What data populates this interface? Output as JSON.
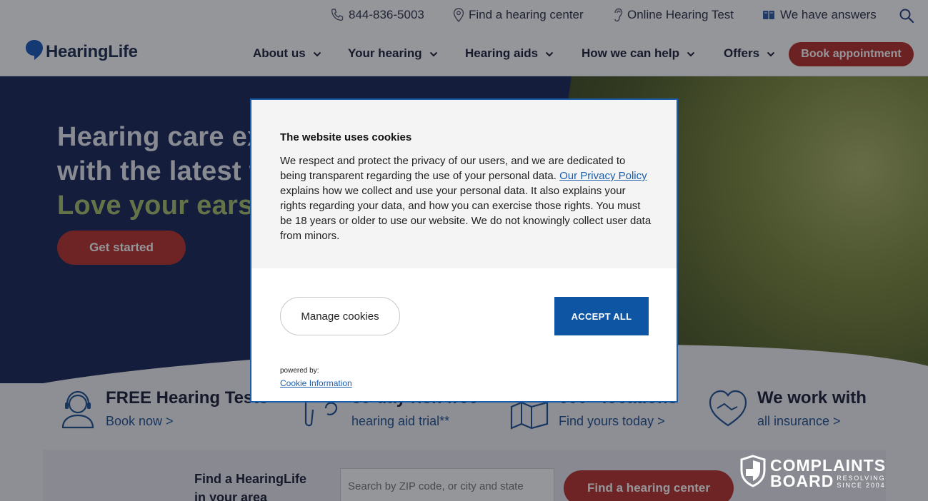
{
  "utility_bar": {
    "phone": "844-836-5003",
    "find_center": "Find a hearing center",
    "online_test": "Online Hearing Test",
    "answers": "We have answers"
  },
  "nav": {
    "logo": "HearingLife",
    "items": [
      "About us",
      "Your hearing",
      "Hearing aids",
      "How we can help",
      "Offers"
    ],
    "book_button": "Book appointment"
  },
  "hero": {
    "line1": "Hearing care ex",
    "line2": "with the latest t",
    "line3": "Love your ears",
    "cta": "Get started"
  },
  "features": [
    {
      "title": "FREE Hearing Tests",
      "link": "Book now >"
    },
    {
      "title": "30-day risk-free",
      "link": "hearing aid trial**"
    },
    {
      "title": "600+ locations",
      "link": "Find yours today >"
    },
    {
      "title": "We work with",
      "link": "all insurance >"
    }
  ],
  "search": {
    "label_line1": "Find a HearingLife",
    "label_line2": "in your area",
    "placeholder": "Search by ZIP code, or city and state",
    "button": "Find a hearing center"
  },
  "cookie_dialog": {
    "title": "The website uses cookies",
    "body_part1": "We respect and protect the privacy of our users, and we are dedicated to being transparent regarding the use of your personal data. ",
    "privacy_link": "Our Privacy Policy",
    "body_part2": " explains how we collect and use your personal data. It also explains your rights regarding your data, and how you can exercise those rights. You must be 18 years or older to use our website. We do not knowingly collect user data from minors.",
    "manage_button": "Manage cookies",
    "accept_button": "ACCEPT ALL",
    "powered_by": "powered by:",
    "provider_link": "Cookie Information"
  },
  "watermark": {
    "line1": "COMPLAINTS",
    "line2": "BOARD",
    "tag1": "RESOLVING",
    "tag2": "SINCE 2004"
  },
  "colors": {
    "brand_red": "#b52a26",
    "accept_blue": "#0e56a4",
    "hero_navy": "#152452",
    "link_blue": "#1d4f91"
  }
}
